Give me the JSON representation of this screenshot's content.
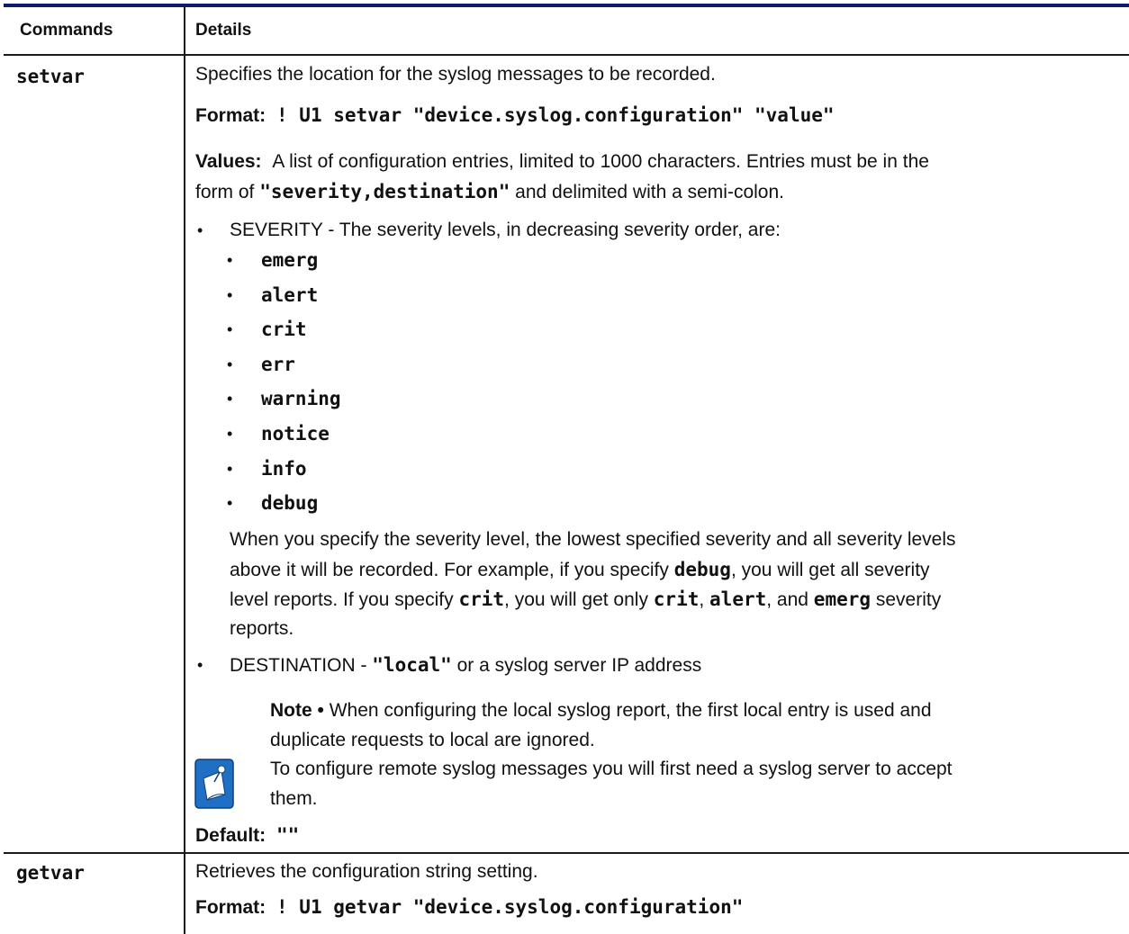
{
  "header": {
    "col1": "Commands",
    "col2": "Details"
  },
  "setvar": {
    "name": "setvar",
    "description": "Specifies the location for the syslog messages to be recorded.",
    "format_label": "Format:",
    "format_value": "! U1 setvar \"device.syslog.configuration\" \"value\"",
    "values_label": "Values:",
    "values_text_1": "A list of configuration entries, limited to 1000 characters. Entries must be in the",
    "values_text_2a": "form of ",
    "values_text_2b": "\"severity,destination\"",
    "values_text_2c": " and delimited with a semi-colon.",
    "severity_intro": "SEVERITY - The severity levels, in decreasing severity order, are:",
    "severity_levels": [
      "emerg",
      "alert",
      "crit",
      "err",
      "warning",
      "notice",
      "info",
      "debug"
    ],
    "explain_1": "When you specify the severity level, the lowest specified severity and all severity levels",
    "explain_2a": "above it will be recorded. For example, if you specify ",
    "explain_2b": "debug",
    "explain_2c": ", you will get all severity",
    "explain_3a": "level reports. If you specify ",
    "explain_3b": "crit",
    "explain_3c": ", you will get only ",
    "explain_3d": "crit",
    "explain_3e": ", ",
    "explain_3f": "alert",
    "explain_3g": ", and ",
    "explain_3h": "emerg",
    "explain_3i": " severity",
    "explain_4": "reports.",
    "destination_a": "DESTINATION - ",
    "destination_b": "\"local\"",
    "destination_c": " or a syslog server IP address",
    "note_label": "Note •",
    "note_1": " When configuring the local syslog report, the first local entry is used and",
    "note_2": "duplicate requests to local are ignored.",
    "note_3": "To configure remote syslog messages you will first need a syslog server to accept",
    "note_4": "them.",
    "default_label": "Default:",
    "default_value": "\"\""
  },
  "getvar": {
    "name": "getvar",
    "description": "Retrieves the configuration string setting.",
    "format_label": "Format:",
    "format_value": "! U1 getvar \"device.syslog.configuration\""
  },
  "colors": {
    "top_rule": "#0d1a6e",
    "note_icon_bg": "#1f6fc4"
  },
  "icons": {
    "note": "note-pencil-icon"
  }
}
